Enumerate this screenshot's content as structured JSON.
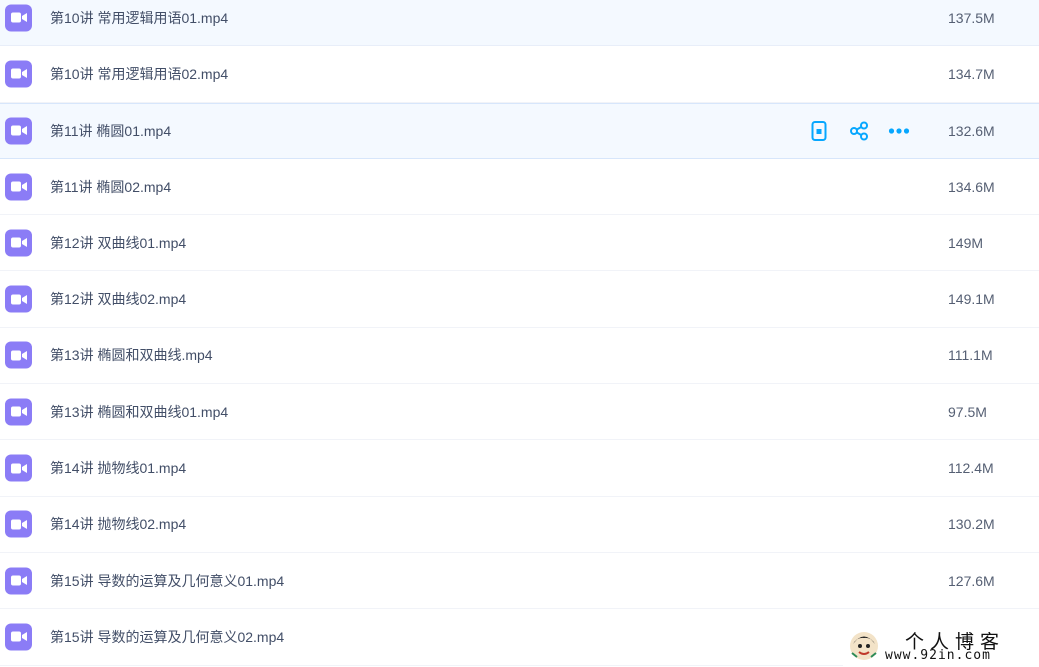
{
  "files": [
    {
      "name": "第10讲 常用逻辑用语01.mp4",
      "size": "137.5M"
    },
    {
      "name": "第10讲 常用逻辑用语02.mp4",
      "size": "134.7M"
    },
    {
      "name": "第11讲 椭圆01.mp4",
      "size": "132.6M"
    },
    {
      "name": "第11讲 椭圆02.mp4",
      "size": "134.6M"
    },
    {
      "name": "第12讲 双曲线01.mp4",
      "size": "149M"
    },
    {
      "name": "第12讲 双曲线02.mp4",
      "size": "149.1M"
    },
    {
      "name": "第13讲 椭圆和双曲线.mp4",
      "size": "111.1M"
    },
    {
      "name": "第13讲 椭圆和双曲线01.mp4",
      "size": "97.5M"
    },
    {
      "name": "第14讲 抛物线01.mp4",
      "size": "112.4M"
    },
    {
      "name": "第14讲 抛物线02.mp4",
      "size": "130.2M"
    },
    {
      "name": "第15讲 导数的运算及几何意义01.mp4",
      "size": "127.6M"
    },
    {
      "name": "第15讲 导数的运算及几何意义02.mp4",
      "size": ""
    }
  ],
  "hovered_row_actions": [
    "phone-icon",
    "share-icon",
    "more-icon"
  ],
  "colors": {
    "video_icon": "#8b7cf6",
    "action_icon": "#06a7ff",
    "hover_bg": "#f4f9ff"
  },
  "watermark": {
    "title": "个人博客",
    "url": "www.92in.com"
  }
}
